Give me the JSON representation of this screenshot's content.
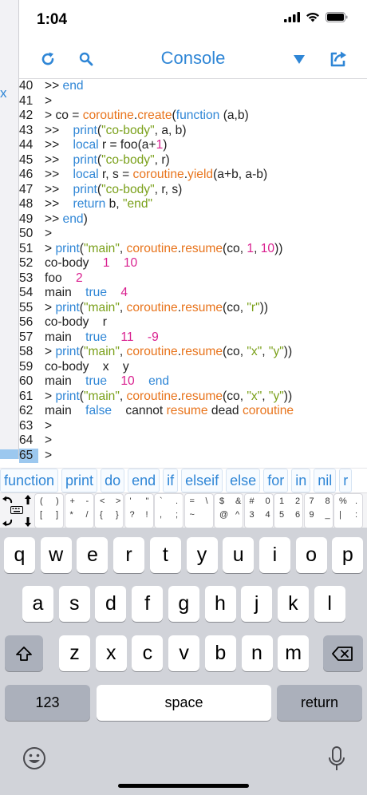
{
  "status_bar": {
    "time": "1:04"
  },
  "nav": {
    "title": "Console"
  },
  "left_panel": {
    "close_glyph": "x"
  },
  "console": {
    "lines": [
      {
        "n": "40",
        "parts": [
          [
            "t",
            ">> "
          ],
          [
            "k",
            "end"
          ]
        ]
      },
      {
        "n": "41",
        "parts": [
          [
            "t",
            ">"
          ]
        ]
      },
      {
        "n": "42",
        "parts": [
          [
            "t",
            "> co = "
          ],
          [
            "f",
            "coroutine"
          ],
          [
            "t",
            "."
          ],
          [
            "f",
            "create"
          ],
          [
            "t",
            "("
          ],
          [
            "k",
            "function"
          ],
          [
            "t",
            " (a,b)"
          ]
        ]
      },
      {
        "n": "43",
        "parts": [
          [
            "t",
            ">>    "
          ],
          [
            "k",
            "print"
          ],
          [
            "t",
            "("
          ],
          [
            "s",
            "\"co-body\""
          ],
          [
            "t",
            ", a, b)"
          ]
        ]
      },
      {
        "n": "44",
        "parts": [
          [
            "t",
            ">>    "
          ],
          [
            "k",
            "local"
          ],
          [
            "t",
            " r = foo(a+"
          ],
          [
            "n",
            "1"
          ],
          [
            "t",
            ")"
          ]
        ]
      },
      {
        "n": "45",
        "parts": [
          [
            "t",
            ">>    "
          ],
          [
            "k",
            "print"
          ],
          [
            "t",
            "("
          ],
          [
            "s",
            "\"co-body\""
          ],
          [
            "t",
            ", r)"
          ]
        ]
      },
      {
        "n": "46",
        "parts": [
          [
            "t",
            ">>    "
          ],
          [
            "k",
            "local"
          ],
          [
            "t",
            " r, s = "
          ],
          [
            "f",
            "coroutine"
          ],
          [
            "t",
            "."
          ],
          [
            "f",
            "yield"
          ],
          [
            "t",
            "(a+b, a-b)"
          ]
        ]
      },
      {
        "n": "47",
        "parts": [
          [
            "t",
            ">>    "
          ],
          [
            "k",
            "print"
          ],
          [
            "t",
            "("
          ],
          [
            "s",
            "\"co-body\""
          ],
          [
            "t",
            ", r, s)"
          ]
        ]
      },
      {
        "n": "48",
        "parts": [
          [
            "t",
            ">>    "
          ],
          [
            "k",
            "return"
          ],
          [
            "t",
            " b, "
          ],
          [
            "s",
            "\"end\""
          ]
        ]
      },
      {
        "n": "49",
        "parts": [
          [
            "t",
            ">> "
          ],
          [
            "k",
            "end"
          ],
          [
            "t",
            ")"
          ]
        ]
      },
      {
        "n": "50",
        "parts": [
          [
            "t",
            ">"
          ]
        ]
      },
      {
        "n": "51",
        "parts": [
          [
            "t",
            "> "
          ],
          [
            "k",
            "print"
          ],
          [
            "t",
            "("
          ],
          [
            "s",
            "\"main\""
          ],
          [
            "t",
            ", "
          ],
          [
            "f",
            "coroutine"
          ],
          [
            "t",
            "."
          ],
          [
            "f",
            "resume"
          ],
          [
            "t",
            "(co, "
          ],
          [
            "n",
            "1"
          ],
          [
            "t",
            ", "
          ],
          [
            "n",
            "10"
          ],
          [
            "t",
            "))"
          ]
        ]
      },
      {
        "n": "52",
        "parts": [
          [
            "t",
            "co-body    "
          ],
          [
            "n",
            "1"
          ],
          [
            "t",
            "    "
          ],
          [
            "n",
            "10"
          ]
        ]
      },
      {
        "n": "53",
        "parts": [
          [
            "t",
            "foo    "
          ],
          [
            "n",
            "2"
          ]
        ]
      },
      {
        "n": "54",
        "parts": [
          [
            "t",
            "main    "
          ],
          [
            "k",
            "true"
          ],
          [
            "t",
            "    "
          ],
          [
            "n",
            "4"
          ]
        ]
      },
      {
        "n": "55",
        "parts": [
          [
            "t",
            "> "
          ],
          [
            "k",
            "print"
          ],
          [
            "t",
            "("
          ],
          [
            "s",
            "\"main\""
          ],
          [
            "t",
            ", "
          ],
          [
            "f",
            "coroutine"
          ],
          [
            "t",
            "."
          ],
          [
            "f",
            "resume"
          ],
          [
            "t",
            "(co, "
          ],
          [
            "s",
            "\"r\""
          ],
          [
            "t",
            "))"
          ]
        ]
      },
      {
        "n": "56",
        "parts": [
          [
            "t",
            "co-body    r"
          ]
        ]
      },
      {
        "n": "57",
        "parts": [
          [
            "t",
            "main    "
          ],
          [
            "k",
            "true"
          ],
          [
            "t",
            "    "
          ],
          [
            "n",
            "11"
          ],
          [
            "t",
            "    "
          ],
          [
            "n",
            "-9"
          ]
        ]
      },
      {
        "n": "58",
        "parts": [
          [
            "t",
            "> "
          ],
          [
            "k",
            "print"
          ],
          [
            "t",
            "("
          ],
          [
            "s",
            "\"main\""
          ],
          [
            "t",
            ", "
          ],
          [
            "f",
            "coroutine"
          ],
          [
            "t",
            "."
          ],
          [
            "f",
            "resume"
          ],
          [
            "t",
            "(co, "
          ],
          [
            "s",
            "\"x\""
          ],
          [
            "t",
            ", "
          ],
          [
            "s",
            "\"y\""
          ],
          [
            "t",
            "))"
          ]
        ]
      },
      {
        "n": "59",
        "parts": [
          [
            "t",
            "co-body    x    y"
          ]
        ]
      },
      {
        "n": "60",
        "parts": [
          [
            "t",
            "main    "
          ],
          [
            "k",
            "true"
          ],
          [
            "t",
            "    "
          ],
          [
            "n",
            "10"
          ],
          [
            "t",
            "    "
          ],
          [
            "k",
            "end"
          ]
        ]
      },
      {
        "n": "61",
        "parts": [
          [
            "t",
            "> "
          ],
          [
            "k",
            "print"
          ],
          [
            "t",
            "("
          ],
          [
            "s",
            "\"main\""
          ],
          [
            "t",
            ", "
          ],
          [
            "f",
            "coroutine"
          ],
          [
            "t",
            "."
          ],
          [
            "f",
            "resume"
          ],
          [
            "t",
            "(co, "
          ],
          [
            "s",
            "\"x\""
          ],
          [
            "t",
            ", "
          ],
          [
            "s",
            "\"y\""
          ],
          [
            "t",
            "))"
          ]
        ]
      },
      {
        "n": "62",
        "parts": [
          [
            "t",
            "main    "
          ],
          [
            "k",
            "false"
          ],
          [
            "t",
            "    cannot "
          ],
          [
            "f",
            "resume"
          ],
          [
            "t",
            " dead "
          ],
          [
            "f",
            "coroutine"
          ]
        ]
      },
      {
        "n": "63",
        "parts": [
          [
            "t",
            ">"
          ]
        ]
      },
      {
        "n": "64",
        "parts": [
          [
            "t",
            ">"
          ]
        ]
      },
      {
        "n": "65",
        "parts": [
          [
            "t",
            ">"
          ]
        ],
        "current": true
      }
    ]
  },
  "suggestions": [
    "function",
    "print",
    "do",
    "end",
    "if",
    "elseif",
    "else",
    "for",
    "in",
    "nil",
    "r"
  ],
  "symbol_keys": [
    [
      "(",
      ")",
      "[",
      "]"
    ],
    [
      "+",
      "-",
      "*",
      "/"
    ],
    [
      "<",
      ">",
      "{",
      "}"
    ],
    [
      "'",
      "\"",
      "?",
      "!"
    ],
    [
      "`",
      ".",
      ",",
      ";"
    ],
    [
      "=",
      "\\",
      "~",
      ""
    ],
    [
      "$",
      "&",
      "@",
      "^"
    ],
    [
      "#",
      "0",
      "3",
      "4"
    ],
    [
      "1",
      "2",
      "5",
      "6"
    ],
    [
      "7",
      "8",
      "9",
      "_"
    ],
    [
      "%",
      ".",
      "|",
      ":"
    ]
  ],
  "keyboard": {
    "row1": [
      "q",
      "w",
      "e",
      "r",
      "t",
      "y",
      "u",
      "i",
      "o",
      "p"
    ],
    "row2": [
      "a",
      "s",
      "d",
      "f",
      "g",
      "h",
      "j",
      "k",
      "l"
    ],
    "row3": [
      "z",
      "x",
      "c",
      "v",
      "b",
      "n",
      "m"
    ],
    "numbers_label": "123",
    "space_label": "space",
    "return_label": "return"
  },
  "colors": {
    "accent": "#2f86d6",
    "string": "#7aa01a",
    "func": "#e8741c",
    "number": "#d9208f"
  }
}
